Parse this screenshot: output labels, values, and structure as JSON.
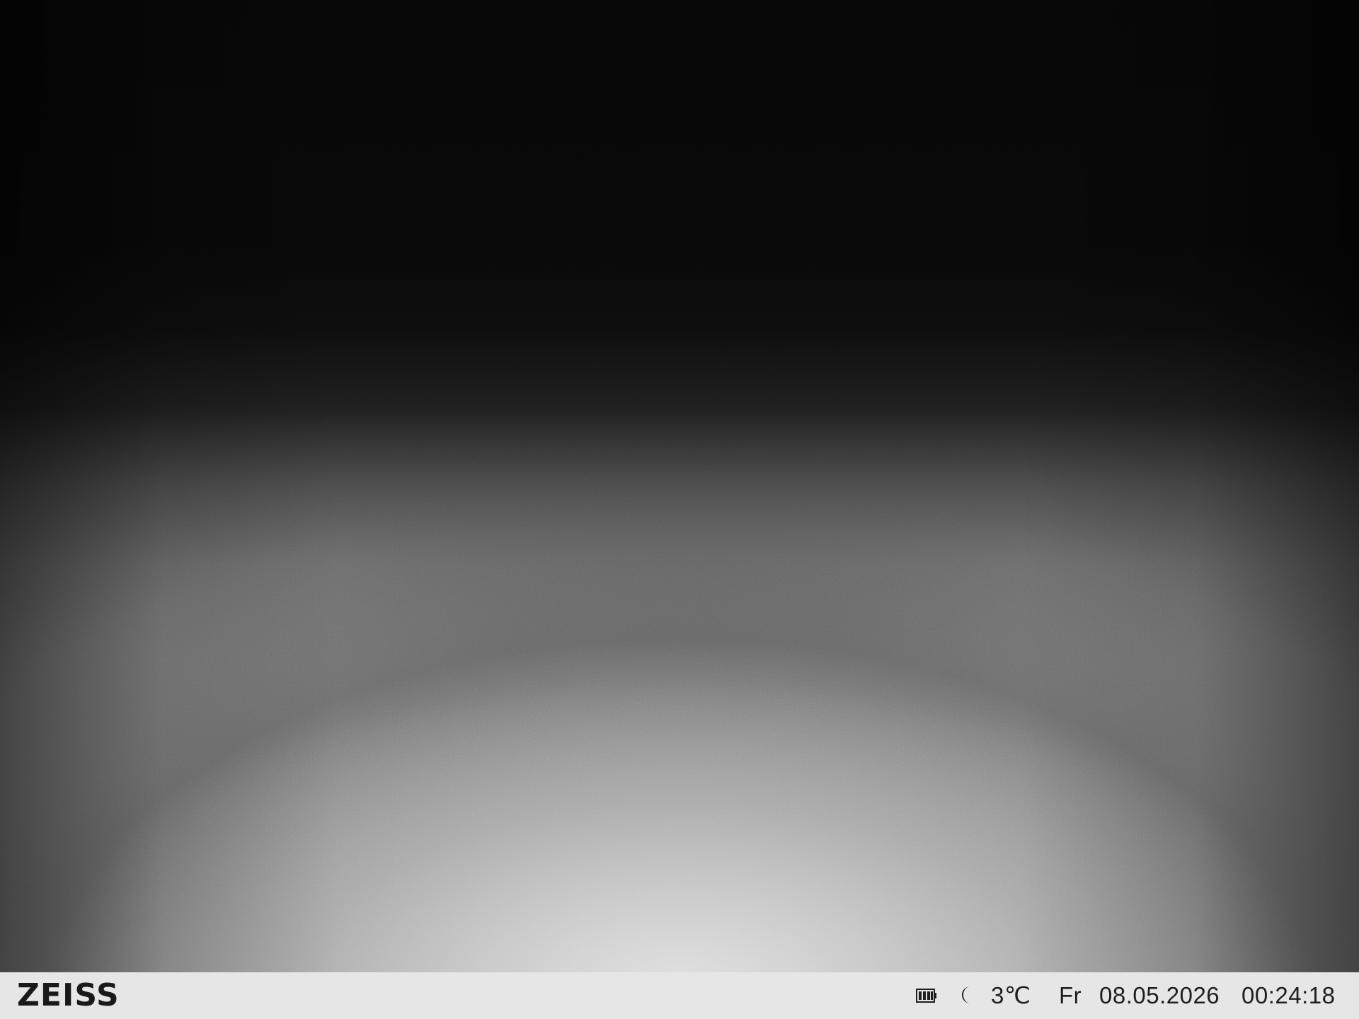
{
  "camera": {
    "brand": "ZEISS",
    "status": {
      "battery_icon": "battery-full-icon",
      "mode_icon": "moon-icon",
      "temperature": "3℃",
      "weekday": "Fr",
      "date": "08.05.2026",
      "time": "00:24:18"
    },
    "colors": {
      "status_bar_bg": "#e6e6e6",
      "status_text": "#1e1e1e"
    }
  }
}
